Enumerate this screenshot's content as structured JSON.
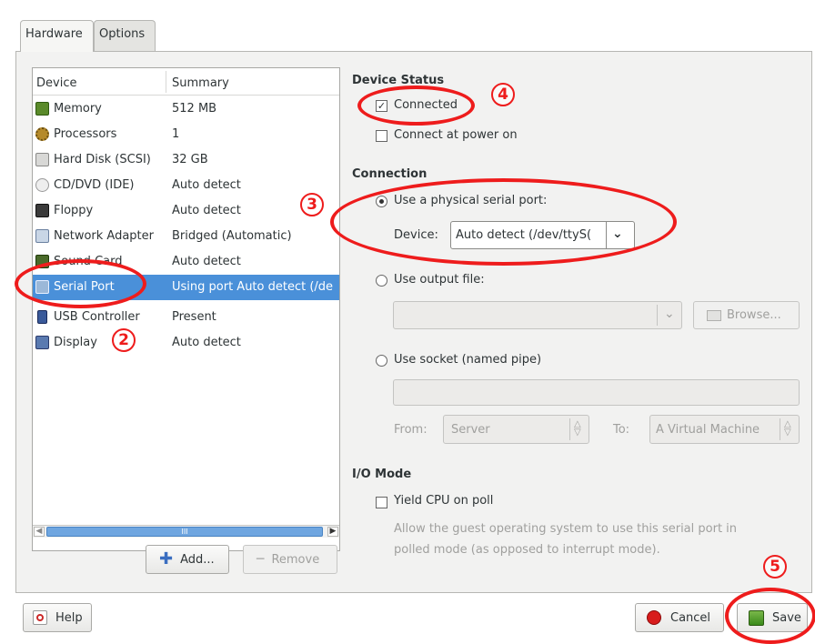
{
  "tabs": [
    {
      "label": "Hardware",
      "active": true
    },
    {
      "label": "Options",
      "active": false
    }
  ],
  "device_list": {
    "columns": [
      "Device",
      "Summary"
    ],
    "rows": [
      {
        "name": "Memory",
        "summary": "512 MB",
        "icon": "memory-icon"
      },
      {
        "name": "Processors",
        "summary": "1",
        "icon": "processor-icon"
      },
      {
        "name": "Hard Disk (SCSI)",
        "summary": "32 GB",
        "icon": "hard-disk-icon"
      },
      {
        "name": "CD/DVD (IDE)",
        "summary": "Auto detect",
        "icon": "cd-dvd-icon"
      },
      {
        "name": "Floppy",
        "summary": "Auto detect",
        "icon": "floppy-icon"
      },
      {
        "name": "Network Adapter",
        "summary": "Bridged (Automatic)",
        "icon": "network-adapter-icon"
      },
      {
        "name": "Sound Card",
        "summary": "Auto detect",
        "icon": "sound-card-icon"
      },
      {
        "name": "Serial Port",
        "summary": "Using port Auto detect (/de",
        "icon": "serial-port-icon",
        "selected": true
      },
      {
        "name": "USB Controller",
        "summary": "Present",
        "icon": "usb-icon"
      },
      {
        "name": "Display",
        "summary": "Auto detect",
        "icon": "display-icon"
      }
    ],
    "scroll_thumb_glyph": "III"
  },
  "buttons": {
    "add": "Add...",
    "remove": "Remove",
    "help": "Help",
    "cancel": "Cancel",
    "save": "Save",
    "browse": "Browse..."
  },
  "device_status": {
    "heading": "Device Status",
    "connected_label": "Connected",
    "connected_checked": true,
    "power_on_label": "Connect at power on",
    "power_on_checked": false
  },
  "connection": {
    "heading": "Connection",
    "physical_label": "Use a physical serial port:",
    "device_label": "Device:",
    "device_value": "Auto detect (/dev/ttyS(",
    "output_file_label": "Use output file:",
    "output_file_value": "",
    "socket_label": "Use socket (named pipe)",
    "socket_value": "",
    "from_label": "From:",
    "from_value": "Server",
    "to_label": "To:",
    "to_value": "A Virtual Machine"
  },
  "io_mode": {
    "heading": "I/O Mode",
    "yield_label": "Yield CPU on poll",
    "yield_checked": false,
    "description_line1": "Allow the guest operating system to use this serial port in",
    "description_line2": "polled mode (as opposed to interrupt mode)."
  },
  "annotations": {
    "m2": "2",
    "m3": "3",
    "m4": "4",
    "m5": "5",
    "color": "#ee1c1c"
  },
  "colors": {
    "selection": "#4a90d9",
    "window_bg": "#f2f2f1"
  }
}
